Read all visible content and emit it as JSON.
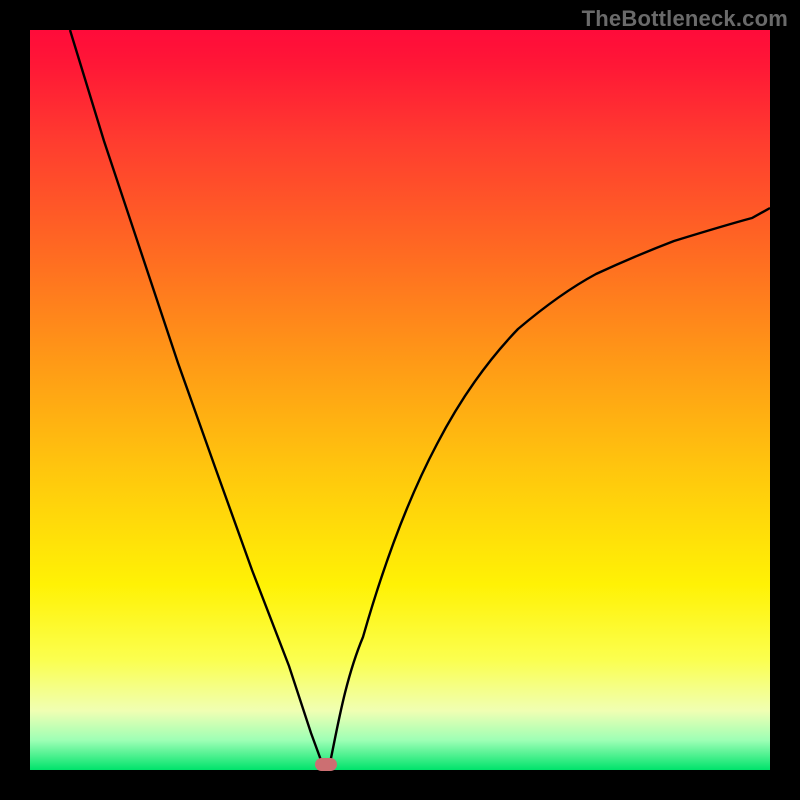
{
  "watermark": "TheBottleneck.com",
  "colors": {
    "frame": "#000000",
    "curve": "#000000",
    "marker": "#cc6f72",
    "gradient_top": "#ff0b3a",
    "gradient_bottom": "#00e36b"
  },
  "chart_data": {
    "type": "line",
    "title": "",
    "xlabel": "",
    "ylabel": "",
    "xlim": [
      0,
      100
    ],
    "ylim": [
      0,
      100
    ],
    "grid": false,
    "annotations": [
      "TheBottleneck.com"
    ],
    "marker": {
      "x": 40,
      "y": 0,
      "shape": "rounded-rect",
      "color": "#cc6f72"
    },
    "series": [
      {
        "name": "left-branch",
        "x": [
          5.4,
          10,
          15,
          20,
          25,
          30,
          35,
          38,
          39.5
        ],
        "y": [
          100,
          85,
          70,
          55,
          41,
          27,
          14,
          5,
          1
        ]
      },
      {
        "name": "right-branch",
        "x": [
          40.5,
          42,
          45,
          50,
          55,
          60,
          65,
          70,
          75,
          80,
          85,
          90,
          95,
          100
        ],
        "y": [
          1,
          6,
          18,
          33,
          44,
          52,
          58,
          62.5,
          66,
          69,
          71.5,
          73.5,
          75,
          76
        ]
      }
    ]
  }
}
